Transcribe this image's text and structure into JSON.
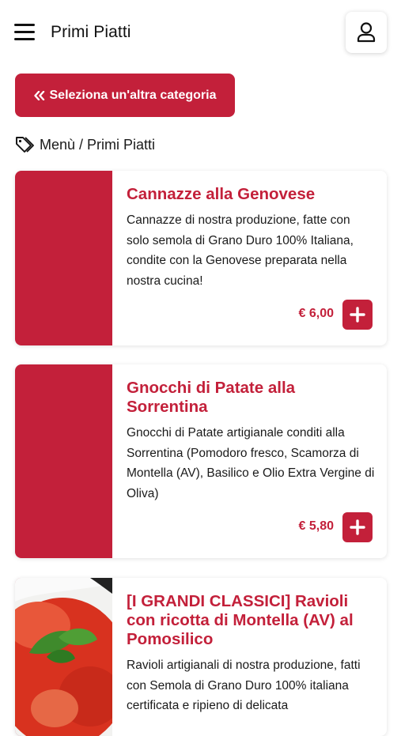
{
  "header": {
    "title": "Primi Piatti",
    "menu_icon": "hamburger-menu-icon",
    "user_icon": "user-icon"
  },
  "category_button": {
    "label": "Seleziona un'altra categoria",
    "icon": "double-chevron-left-icon"
  },
  "breadcrumb": {
    "icon": "tags-icon",
    "items": [
      "Menù",
      "Primi Piatti"
    ],
    "separator": "/"
  },
  "products": [
    {
      "title": "Cannazze alla Genovese",
      "description": "Cannazze di nostra produzione, fatte con solo semola di Grano Duro 100% Italiana, condite con la Genovese preparata nella nostra cucina!",
      "price": "€ 6,00"
    },
    {
      "title": "Gnocchi di Patate alla Sorrentina",
      "description": "Gnocchi di Patate artigianale conditi alla Sorrentina (Pomodoro fresco, Scamorza di Montella (AV), Basilico e Olio Extra Vergine di Oliva)",
      "price": "€ 5,80"
    },
    {
      "title": "[I GRANDI CLASSICI] Ravioli con ricotta di Montella (AV) al Pomosilico",
      "description": "Ravioli artigianali di nostra produzione, fatti con Semola di Grano Duro 100% italiana certificata e ripieno di delicata",
      "price": ""
    }
  ],
  "colors": {
    "accent": "#c3203a",
    "text": "#1a1a1a",
    "background": "#ffffff"
  }
}
